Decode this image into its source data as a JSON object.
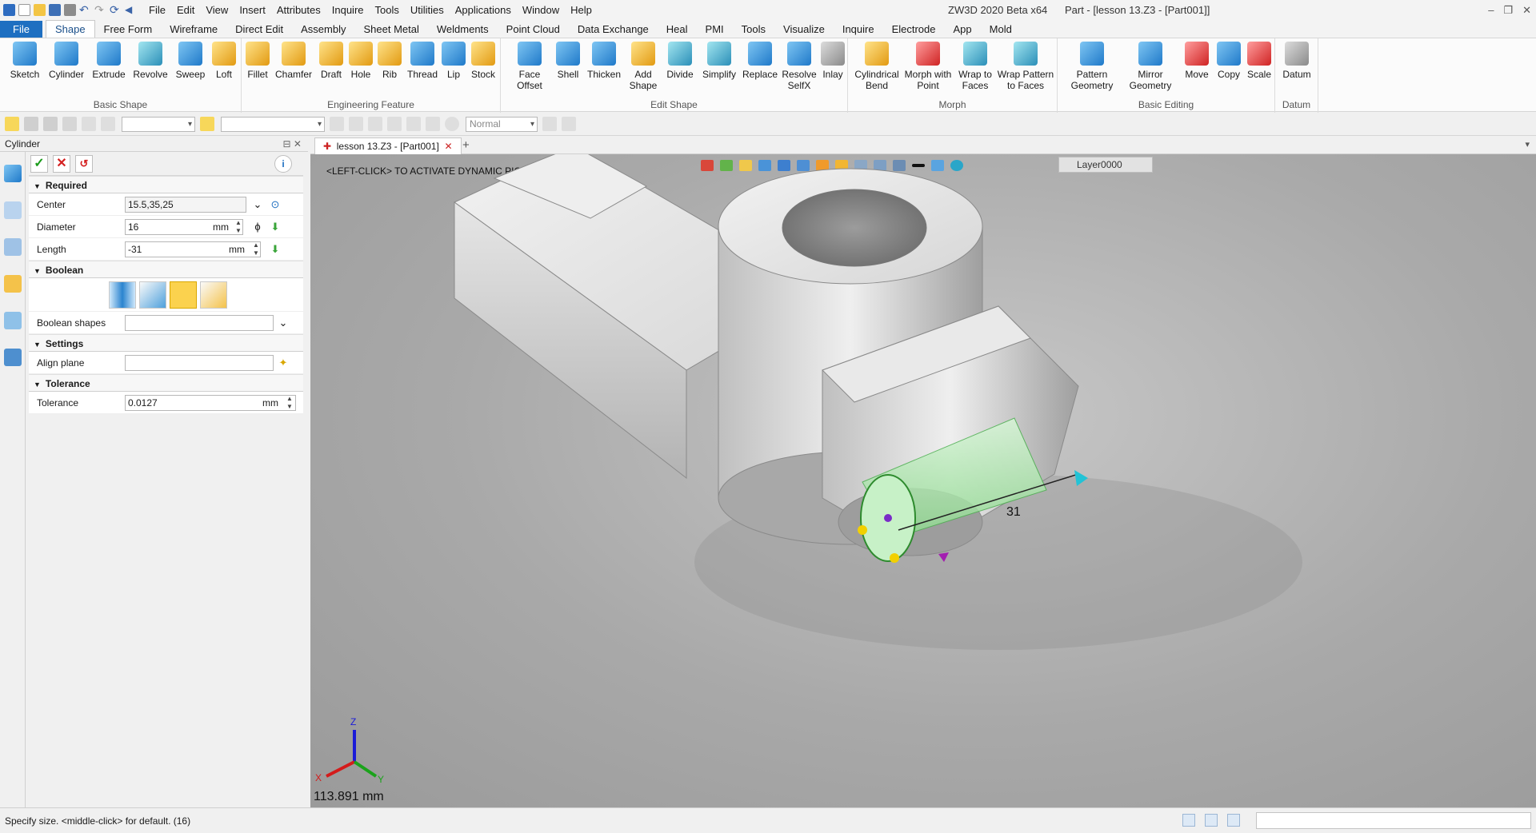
{
  "app": {
    "window_title": "ZW3D 2020 Beta x64",
    "document_title": "Part - [lesson 13.Z3 - [Part001]]"
  },
  "menubar": [
    "File",
    "Edit",
    "View",
    "Insert",
    "Attributes",
    "Inquire",
    "Tools",
    "Utilities",
    "Applications",
    "Window",
    "Help"
  ],
  "ribbon_tabs": [
    "File",
    "Shape",
    "Free Form",
    "Wireframe",
    "Direct Edit",
    "Assembly",
    "Sheet Metal",
    "Weldments",
    "Point Cloud",
    "Data Exchange",
    "Heal",
    "PMI",
    "Tools",
    "Visualize",
    "Inquire",
    "Electrode",
    "App",
    "Mold"
  ],
  "active_tab": "Shape",
  "ribbon_groups": [
    {
      "label": "Basic Shape",
      "buttons": [
        "Sketch",
        "Cylinder",
        "Extrude",
        "Revolve",
        "Sweep",
        "Loft"
      ]
    },
    {
      "label": "Engineering Feature",
      "buttons": [
        "Fillet",
        "Chamfer",
        "Draft",
        "Hole",
        "Rib",
        "Thread",
        "Lip",
        "Stock"
      ]
    },
    {
      "label": "Edit Shape",
      "buttons": [
        "Face Offset",
        "Shell",
        "Thicken",
        "Add Shape",
        "Divide",
        "Simplify",
        "Replace",
        "Resolve SelfX",
        "Inlay"
      ]
    },
    {
      "label": "Morph",
      "buttons": [
        "Cylindrical Bend",
        "Morph with Point",
        "Wrap to Faces",
        "Wrap Pattern to Faces"
      ]
    },
    {
      "label": "Basic Editing",
      "buttons": [
        "Pattern Geometry",
        "Mirror Geometry",
        "Move",
        "Copy",
        "Scale"
      ]
    },
    {
      "label": "Datum",
      "buttons": [
        "Datum"
      ]
    }
  ],
  "toolbar": {
    "render_mode": "Normal"
  },
  "panel": {
    "title": "Cylinder",
    "required_label": "Required",
    "center_label": "Center",
    "center_value": "15.5,35,25",
    "diameter_label": "Diameter",
    "diameter_value": "16",
    "diameter_unit": "mm",
    "length_label": "Length",
    "length_value": "-31",
    "length_unit": "mm",
    "boolean_label": "Boolean",
    "boolean_shapes_label": "Boolean shapes",
    "settings_label": "Settings",
    "align_plane_label": "Align plane",
    "tolerance_section_label": "Tolerance",
    "tolerance_label": "Tolerance",
    "tolerance_value": "0.0127",
    "tolerance_unit": "mm"
  },
  "doc_tab": "lesson 13.Z3 - [Part001]",
  "viewport": {
    "prompt": "<LEFT-CLICK> TO ACTIVATE DYNAMIC PICK INPUT.",
    "layer": "Layer0000",
    "dimension_label": "31",
    "distance": "113.891 mm"
  },
  "status": {
    "message": "Specify size.  <middle-click> for default. (16)"
  },
  "colors": {
    "accent": "#1e6fc1",
    "preview_green": "#a6e8a6",
    "ok_green": "#1a9b1a",
    "cancel_red": "#d42020"
  }
}
